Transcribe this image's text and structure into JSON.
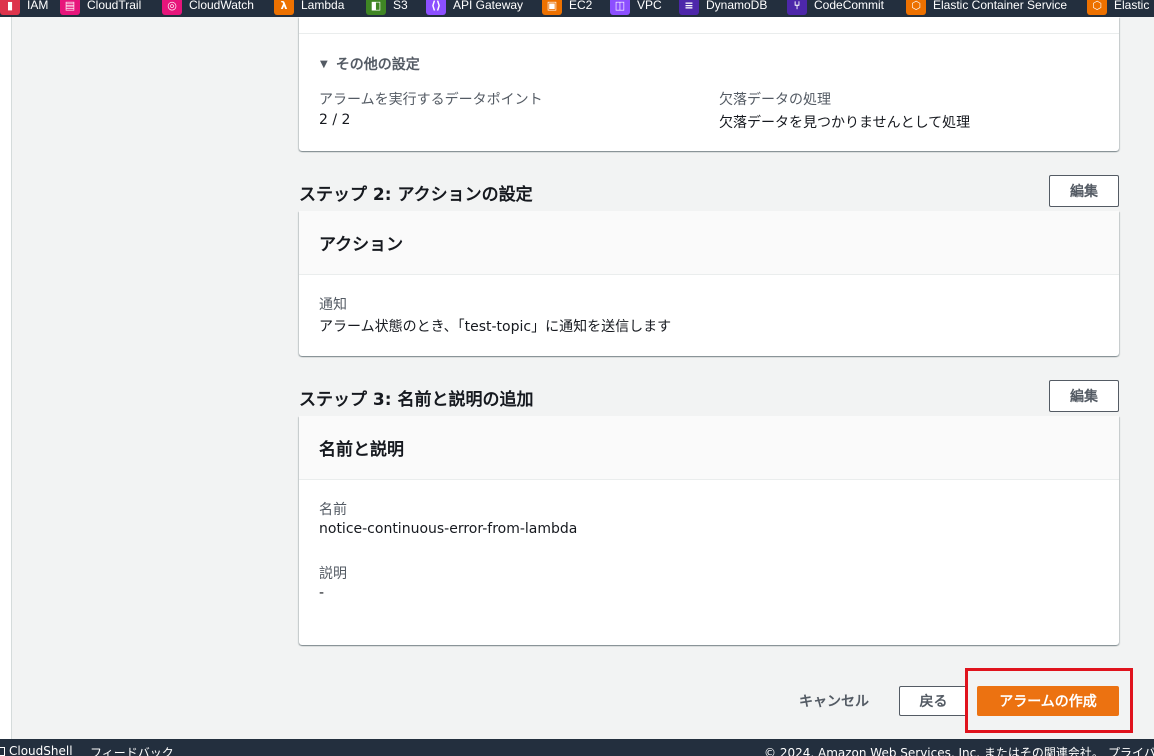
{
  "favorites": [
    {
      "label": "IAM",
      "icon": "iam-icon",
      "color": "#dd344c"
    },
    {
      "label": "CloudTrail",
      "icon": "cloudtrail-icon",
      "color": "#e7157b"
    },
    {
      "label": "CloudWatch",
      "icon": "cloudwatch-icon",
      "color": "#e7157b"
    },
    {
      "label": "Lambda",
      "icon": "lambda-icon",
      "color": "#ed7100"
    },
    {
      "label": "S3",
      "icon": "s3-icon",
      "color": "#3f8624"
    },
    {
      "label": "API Gateway",
      "icon": "api-gateway-icon",
      "color": "#8c4fff"
    },
    {
      "label": "EC2",
      "icon": "ec2-icon",
      "color": "#ed7100"
    },
    {
      "label": "VPC",
      "icon": "vpc-icon",
      "color": "#8c4fff"
    },
    {
      "label": "DynamoDB",
      "icon": "dynamodb-icon",
      "color": "#4d27aa"
    },
    {
      "label": "CodeCommit",
      "icon": "codecommit-icon",
      "color": "#4d27aa"
    },
    {
      "label": "Elastic Container Service",
      "icon": "ecs-icon",
      "color": "#ed7100"
    },
    {
      "label": "Elastic",
      "icon": "elastic-icon",
      "color": "#ed7100"
    }
  ],
  "step1": {
    "more_settings_label": "その他の設定",
    "datapoints_key": "アラームを実行するデータポイント",
    "datapoints_val": "2 / 2",
    "missing_key": "欠落データの処理",
    "missing_val": "欠落データを見つかりませんとして処理"
  },
  "step2": {
    "title": "ステップ 2: アクションの設定",
    "edit": "編集",
    "card_title": "アクション",
    "notify_key": "通知",
    "notify_val": "アラーム状態のとき、「test-topic」に通知を送信します"
  },
  "step3": {
    "title": "ステップ 3: 名前と説明の追加",
    "edit": "編集",
    "card_title": "名前と説明",
    "name_key": "名前",
    "name_val": "notice-continuous-error-from-lambda",
    "desc_key": "説明",
    "desc_val": "-"
  },
  "actions": {
    "cancel": "キャンセル",
    "back": "戻る",
    "create": "アラームの作成"
  },
  "footer": {
    "cloudshell": "CloudShell",
    "feedback": "フィードバック",
    "copyright": "© 2024, Amazon Web Services, Inc. またはその関連会社。",
    "privacy": "プライバシー"
  },
  "colors": {
    "primary_button": "#ec7211",
    "highlight_box": "#e0131d",
    "nav_bg": "#232f3e"
  }
}
